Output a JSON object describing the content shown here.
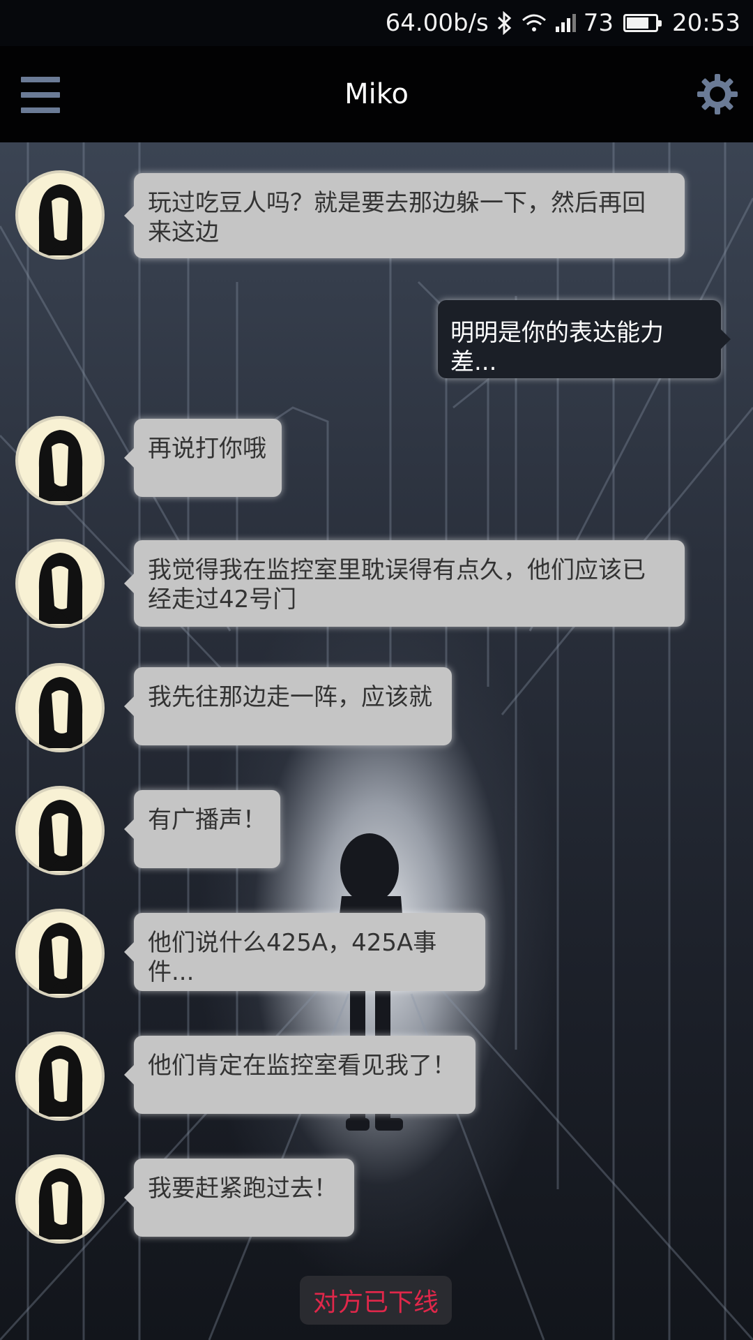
{
  "status_bar": {
    "net_speed": "64.00b/s",
    "signal_level": "73",
    "time": "20:53",
    "icons": [
      "bluetooth-icon",
      "wifi-icon",
      "cell-signal-icon",
      "battery-icon"
    ]
  },
  "app_bar": {
    "title": "Miko",
    "menu_icon": "hamburger-menu-icon",
    "settings_icon": "gear-icon"
  },
  "messages": [
    {
      "from": "contact",
      "text": "玩过吃豆人吗？就是要去那边躲一下，然后再回\n来这边"
    },
    {
      "from": "me",
      "text": "明明是你的表达能力差..."
    },
    {
      "from": "contact",
      "text": "再说打你哦"
    },
    {
      "from": "contact",
      "text": "我觉得我在监控室里耽误得有点久，他们应该已\n经走过42号门"
    },
    {
      "from": "contact",
      "text": "我先往那边走一阵，应该就"
    },
    {
      "from": "contact",
      "text": "有广播声！"
    },
    {
      "from": "contact",
      "text": "他们说什么425A，425A事件..."
    },
    {
      "from": "contact",
      "text": "他们肯定在监控室看见我了！"
    },
    {
      "from": "contact",
      "text": "我要赶紧跑过去！"
    }
  ],
  "footer": {
    "offline_text": "对方已下线"
  },
  "colors": {
    "incoming_bubble": "#c5c5c5",
    "outgoing_bubble": "#1b1f27",
    "offline_text": "#e0274a",
    "accent_icon": "#6b7b96"
  }
}
